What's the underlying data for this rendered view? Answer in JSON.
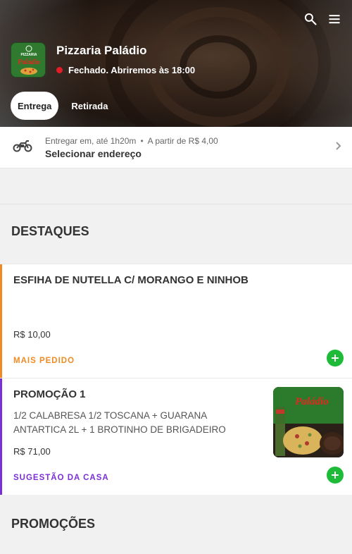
{
  "store": {
    "name": "Pizzaria Paládio",
    "status": "Fechado. Abriremos às 18:00",
    "logo_text_top": "PIZZARIA",
    "logo_text_main": "Paládio"
  },
  "header": {
    "search_icon": "search-icon",
    "menu_icon": "menu-icon"
  },
  "tabs": [
    {
      "label": "Entrega",
      "active": true
    },
    {
      "label": "Retirada",
      "active": false
    }
  ],
  "address": {
    "deliver_label": "Entregar em,",
    "time": "até 1h20m",
    "separator": "•",
    "min_price": "A partir de R$ 4,00",
    "select_label": "Selecionar endereço"
  },
  "sections": {
    "highlights_title": "DESTAQUES",
    "promotions_title": "PROMOÇÕES"
  },
  "products": [
    {
      "name": "ESFIHA DE NUTELLA C/ MORANGO E NINHOB",
      "description": "",
      "price": "R$ 10,00",
      "tag": "MAIS PEDIDO",
      "tag_color": "#f08a24"
    },
    {
      "name": "PROMOÇÃO 1",
      "description": "1/2 CALABRESA 1/2 TOSCANA + GUARANA ANTARTICA 2L + 1 BROTINHO DE BRIGADEIRO",
      "price": "R$ 71,00",
      "tag": "SUGESTÃO DA CASA",
      "tag_color": "#7b2fd6"
    }
  ],
  "colors": {
    "add_button": "#1dbb38",
    "status_dot": "#e11d2a"
  }
}
